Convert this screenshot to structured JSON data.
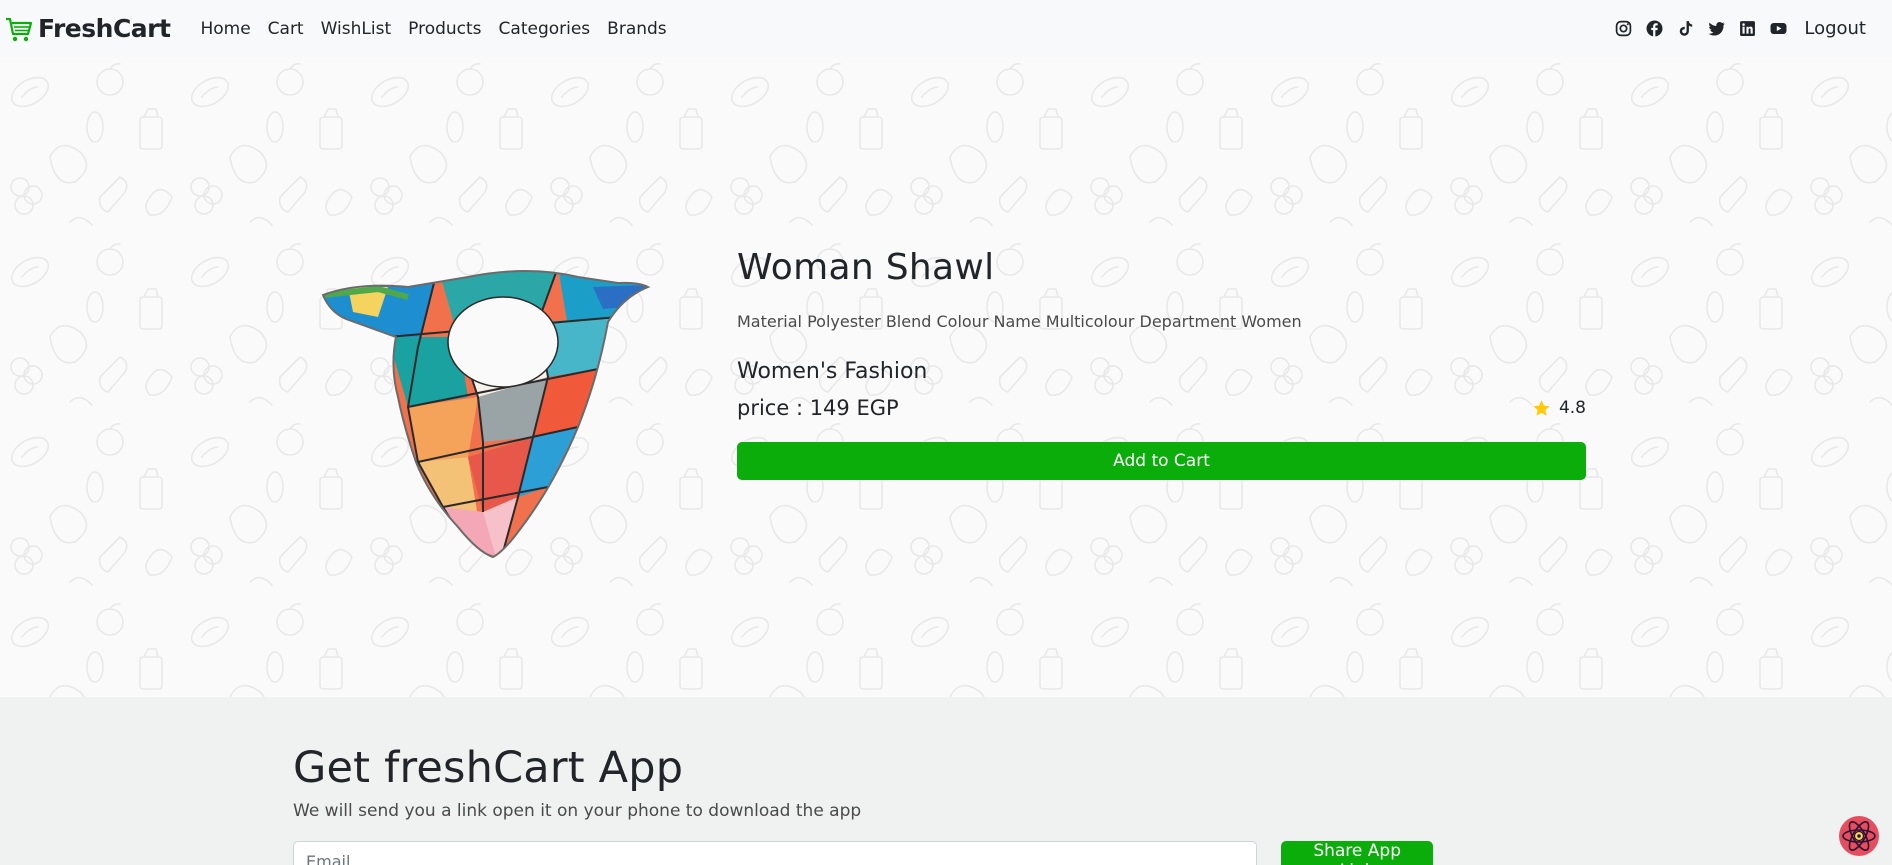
{
  "navbar": {
    "brand": "FreshCart",
    "links": [
      "Home",
      "Cart",
      "WishList",
      "Products",
      "Categories",
      "Brands"
    ],
    "social_icons": [
      "instagram-icon",
      "facebook-icon",
      "tiktok-icon",
      "twitter-icon",
      "linkedin-icon",
      "youtube-icon"
    ],
    "logout": "Logout"
  },
  "product": {
    "title": "Woman Shawl",
    "description": "Material Polyester Blend Colour Name Multicolour Department Women",
    "category": "Women's Fashion",
    "price": "price : 149 EGP",
    "rating": "4.8",
    "add_to_cart": "Add to Cart"
  },
  "app": {
    "title": "Get freshCart App",
    "subtitle": "We will send you a link open it on your phone to download the app",
    "email_placeholder": "Email",
    "share_button": "Share App Link"
  },
  "colors": {
    "accent": "#0aad0a",
    "navbar_bg": "#f8f9fa",
    "app_section_bg": "#f0f2f1",
    "star": "#ffc908"
  }
}
